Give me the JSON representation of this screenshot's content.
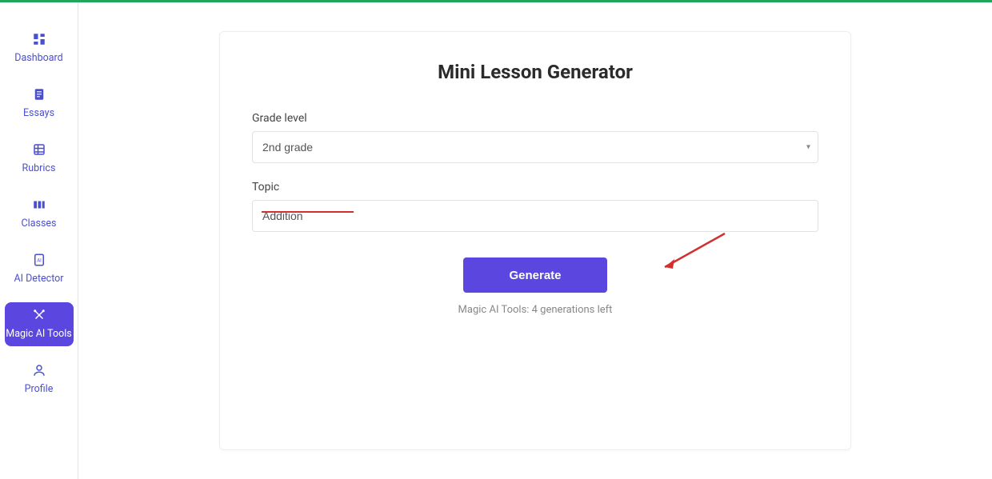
{
  "sidebar": {
    "items": [
      {
        "label": "Dashboard",
        "icon": "dashboard-icon",
        "active": false
      },
      {
        "label": "Essays",
        "icon": "essays-icon",
        "active": false
      },
      {
        "label": "Rubrics",
        "icon": "rubrics-icon",
        "active": false
      },
      {
        "label": "Classes",
        "icon": "classes-icon",
        "active": false
      },
      {
        "label": "AI Detector",
        "icon": "ai-detector-icon",
        "active": false
      },
      {
        "label": "Magic AI Tools",
        "icon": "magic-tools-icon",
        "active": true
      },
      {
        "label": "Profile",
        "icon": "profile-icon",
        "active": false
      }
    ]
  },
  "main": {
    "title": "Mini Lesson Generator",
    "grade_label": "Grade level",
    "grade_value": "2nd grade",
    "topic_label": "Topic",
    "topic_value": "Addition",
    "generate_label": "Generate",
    "status_text": "Magic AI Tools: 4 generations left"
  },
  "colors": {
    "accent": "#5b47e0",
    "brand_green": "#22a45d",
    "annotation_red": "#d32f2f"
  }
}
